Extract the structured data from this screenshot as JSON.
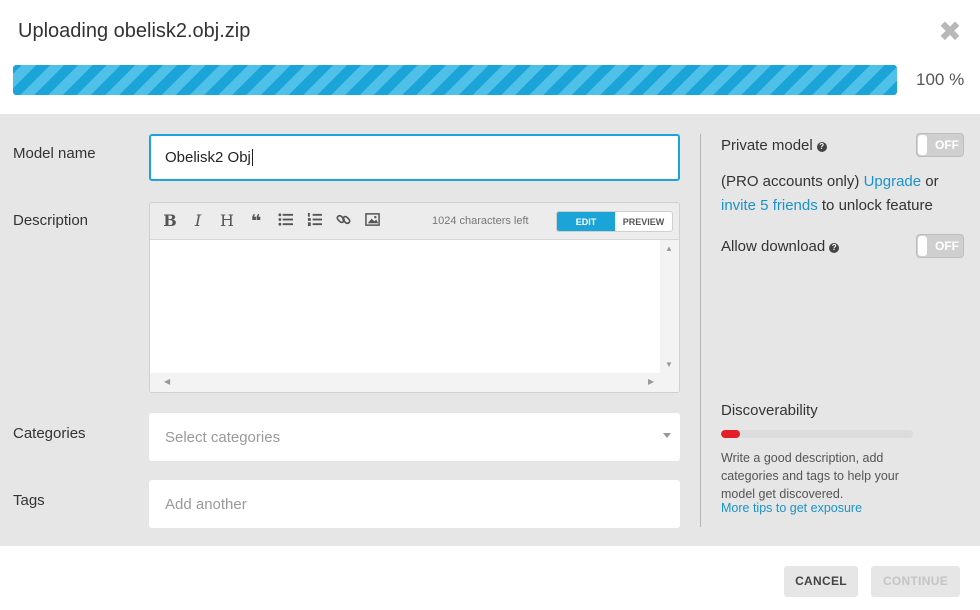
{
  "dialog": {
    "title": "Uploading obelisk2.obj.zip",
    "progress": {
      "percent_label": "100 %",
      "fraction": 1.0
    }
  },
  "form": {
    "model_name": {
      "label": "Model name",
      "value": "Obelisk2 Obj"
    },
    "description": {
      "label": "Description",
      "toolbar": [
        "bold",
        "italic",
        "heading",
        "quote",
        "bulleted-list",
        "numbered-list",
        "link",
        "image"
      ],
      "bold_glyph": "B",
      "italic_glyph": "I",
      "heading_glyph": "H",
      "quote_glyph": "❝",
      "chars_left": "1024 characters left",
      "mode_edit": "EDIT",
      "mode_preview": "PREVIEW"
    },
    "categories": {
      "label": "Categories",
      "placeholder": "Select categories"
    },
    "tags": {
      "label": "Tags",
      "placeholder": "Add another"
    }
  },
  "settings": {
    "private_model": {
      "label": "Private model",
      "toggle": "OFF"
    },
    "pro_note": {
      "before": "(PRO accounts only) ",
      "upgrade_link": "Upgrade",
      "or": " or",
      "invite_link": "invite 5 friends",
      "after": " to unlock feature"
    },
    "allow_download": {
      "label": "Allow download",
      "toggle": "OFF"
    },
    "help_glyph": "?",
    "discoverability": {
      "label": "Discoverability",
      "level": 0.1,
      "hint": "Write a good description, add categories and tags to help your model get discovered.",
      "link": "More tips to get exposure"
    }
  },
  "footer": {
    "cancel": "CANCEL",
    "continue": "CONTINUE"
  },
  "colors": {
    "accent": "#1ba4d8",
    "danger": "#e41e26",
    "body_bg": "#e6e6e6"
  }
}
